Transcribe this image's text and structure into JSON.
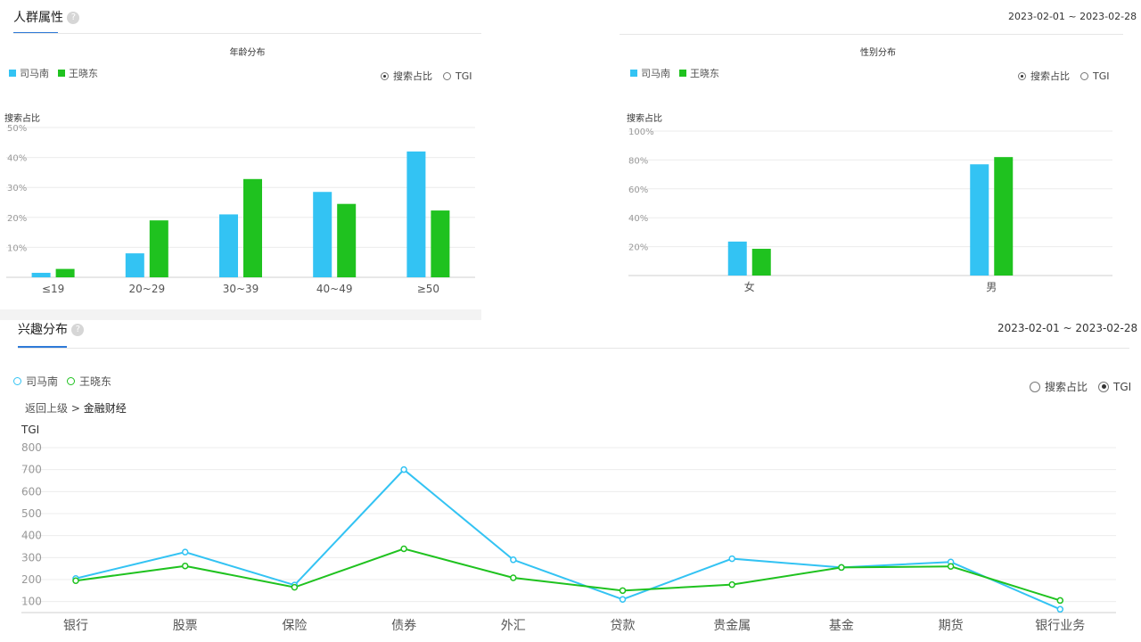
{
  "people_panel": {
    "title": "人群属性",
    "help_icon": "?",
    "date_range": "2023-02-01 ~ 2023-02-28"
  },
  "interest_panel": {
    "title": "兴趣分布",
    "help_icon": "?",
    "date_range": "2023-02-01 ~ 2023-02-28",
    "breadcrumb": {
      "back": "返回上级",
      "separator": ">",
      "current": "金融财经"
    }
  },
  "legend": {
    "series_a": "司马南",
    "series_b": "王晓东"
  },
  "radio": {
    "share": "搜索占比",
    "tgi": "TGI"
  },
  "colors": {
    "series_a": "#33c3f3",
    "series_b": "#1fc21f",
    "accent": "#2f7bd8"
  },
  "chart_data": [
    {
      "id": "age",
      "type": "bar",
      "title": "年龄分布",
      "ylabel": "搜索占比",
      "ylim": [
        0,
        50
      ],
      "yticks": [
        "10%",
        "20%",
        "30%",
        "40%",
        "50%"
      ],
      "ytick_values": [
        10,
        20,
        30,
        40,
        50
      ],
      "categories": [
        "≤19",
        "20~29",
        "30~39",
        "40~49",
        "≥50"
      ],
      "series": [
        {
          "name": "司马南",
          "values": [
            1.5,
            8,
            21,
            28.5,
            42
          ]
        },
        {
          "name": "王晓东",
          "values": [
            2.8,
            19,
            32.8,
            24.5,
            22.3
          ]
        }
      ],
      "selected_metric": "搜索占比",
      "legend_position": "top-left",
      "grid": true
    },
    {
      "id": "gender",
      "type": "bar",
      "title": "性别分布",
      "ylabel": "搜索占比",
      "ylim": [
        0,
        100
      ],
      "yticks": [
        "20%",
        "40%",
        "60%",
        "80%",
        "100%"
      ],
      "ytick_values": [
        20,
        40,
        60,
        80,
        100
      ],
      "categories": [
        "女",
        "男"
      ],
      "series": [
        {
          "name": "司马南",
          "values": [
            23.5,
            77
          ]
        },
        {
          "name": "王晓东",
          "values": [
            18.5,
            82
          ]
        }
      ],
      "selected_metric": "搜索占比",
      "legend_position": "top-left",
      "grid": true
    },
    {
      "id": "interest",
      "type": "line",
      "ylabel": "TGI",
      "ylim": [
        50,
        800
      ],
      "yticks": [
        "100",
        "200",
        "300",
        "400",
        "500",
        "600",
        "700",
        "800"
      ],
      "ytick_values": [
        100,
        200,
        300,
        400,
        500,
        600,
        700,
        800
      ],
      "categories": [
        "银行",
        "股票",
        "保险",
        "债券",
        "外汇",
        "贷款",
        "贵金属",
        "基金",
        "期货",
        "银行业务"
      ],
      "series": [
        {
          "name": "司马南",
          "values": [
            205,
            325,
            175,
            700,
            290,
            110,
            295,
            255,
            280,
            65
          ]
        },
        {
          "name": "王晓东",
          "values": [
            195,
            262,
            165,
            340,
            208,
            150,
            177,
            255,
            260,
            105
          ]
        }
      ],
      "selected_metric": "TGI",
      "legend_position": "top-left",
      "grid": true
    }
  ]
}
